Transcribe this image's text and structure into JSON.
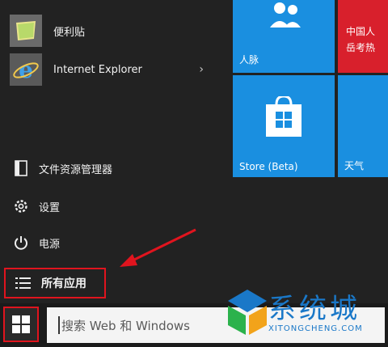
{
  "apps": [
    {
      "label": "便利贴",
      "icon": "sticky-notes-icon"
    },
    {
      "label": "Internet Explorer",
      "icon": "internet-explorer-icon",
      "chevron": "›"
    }
  ],
  "system": {
    "file_explorer": "文件资源管理器",
    "settings": "设置",
    "power": "电源",
    "all_apps": "所有应用"
  },
  "tiles": {
    "people": "人脉",
    "store": "Store (Beta)",
    "weather": "天气",
    "news_line1": "中国人",
    "news_line2": "岳考热"
  },
  "taskbar": {
    "search_placeholder": "搜索 Web 和 Windows"
  },
  "watermark": {
    "title": "系统城",
    "subtitle": "XITONGCHENG.COM"
  },
  "colors": {
    "tile_blue": "#1a8fe0",
    "tile_red": "#d8202c",
    "highlight": "#e0141e"
  }
}
